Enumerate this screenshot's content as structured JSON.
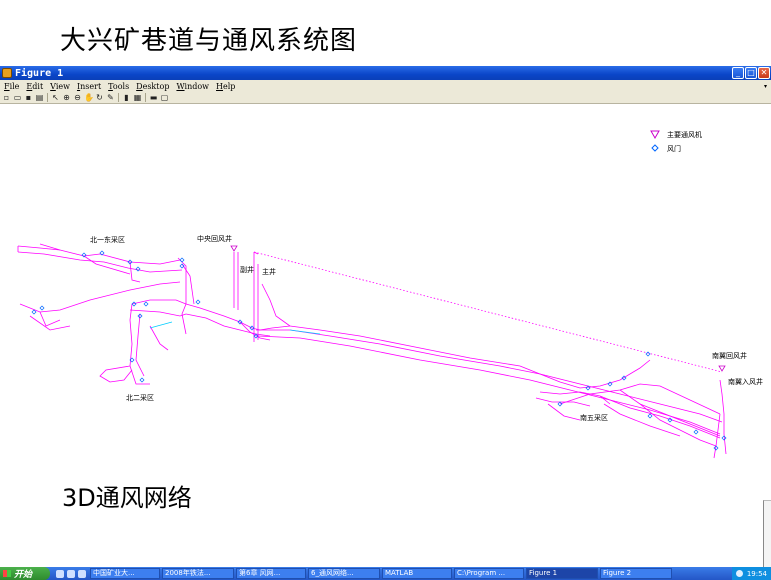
{
  "slide": {
    "title": "大兴矿巷道与通风系统图",
    "caption": "3D通风网络"
  },
  "window": {
    "title": "Figure 1",
    "icon": "matlab-figure-icon",
    "controls": [
      "minimize-icon",
      "maximize-icon",
      "close-icon"
    ]
  },
  "menubar": {
    "items": [
      "File",
      "Edit",
      "View",
      "Insert",
      "Tools",
      "Desktop",
      "Window",
      "Help"
    ]
  },
  "toolbar": {
    "icons": [
      "new-file-icon",
      "open-file-icon",
      "save-icon",
      "print-icon",
      "pointer-icon",
      "zoom-in-icon",
      "zoom-out-icon",
      "pan-icon",
      "rotate-3d-icon",
      "data-cursor-icon",
      "colorbar-icon",
      "legend-icon",
      "hide-plot-tools-icon",
      "show-plot-tools-icon"
    ]
  },
  "plot": {
    "legend": [
      {
        "marker": "down-triangle",
        "label": "主要通风机",
        "color": "#cc00cc"
      },
      {
        "marker": "diamond",
        "label": "风门",
        "color": "#0066ff"
      }
    ],
    "labels": {
      "north1": "北一东采区",
      "central_shaft": "中央回风井",
      "aux_shaft": "副井",
      "main_shaft": "主井",
      "north2": "北二采区",
      "south_return": "南翼回风井",
      "south_intake": "南翼入风井",
      "south5": "南五采区"
    },
    "colors": {
      "tunnel": "#ff00ff",
      "door": "#0066ff",
      "accent": "#00ccff"
    }
  },
  "taskbar": {
    "start_label": "开始",
    "tasks": [
      "中国矿业大...",
      "2008年铁法...",
      "第6章  风网...",
      "6_通风网络...",
      "MATLAB",
      "C:\\Program ...",
      "Figure 1",
      "Figure 2"
    ],
    "active_task": "Figure 1",
    "clock": "19:54"
  }
}
